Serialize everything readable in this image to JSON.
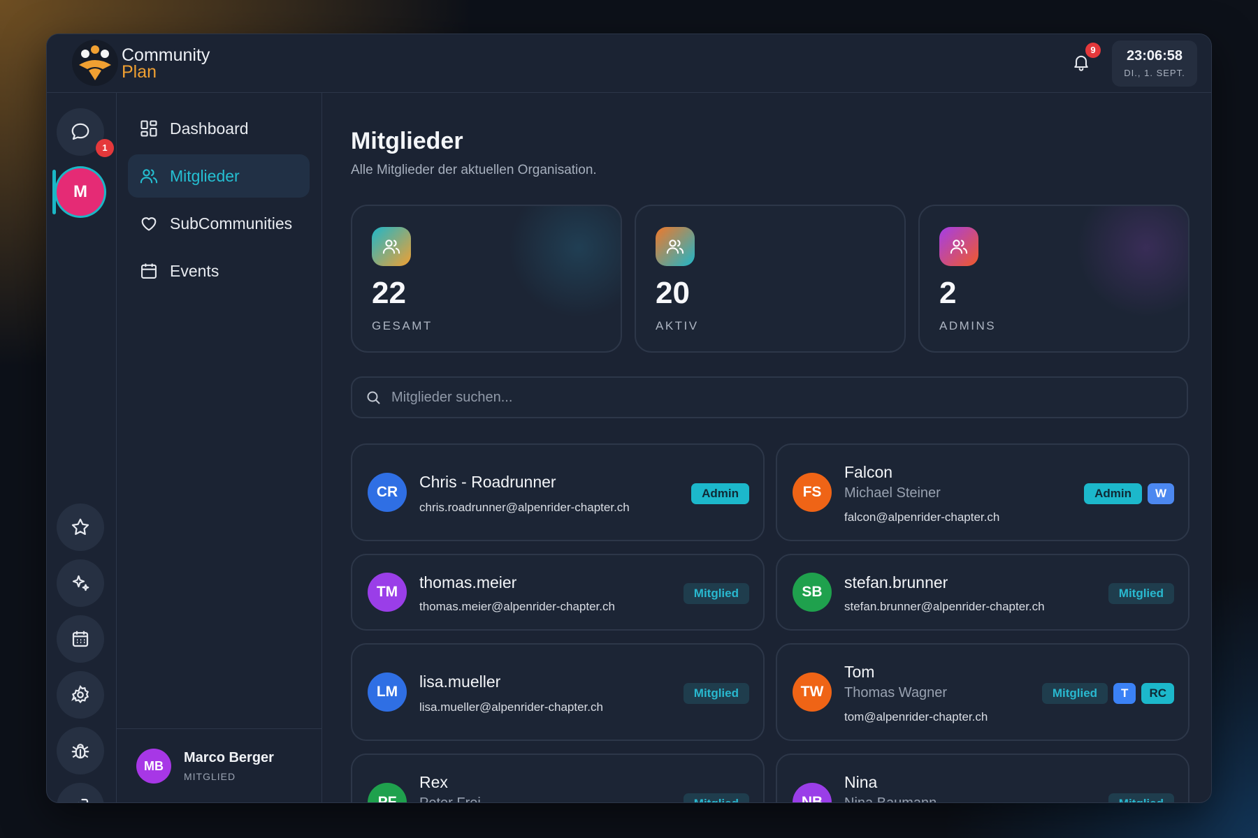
{
  "app": {
    "brand_line1": "Community",
    "brand_line2": "Plan"
  },
  "header": {
    "notification_count": "9",
    "time": "23:06:58",
    "date": "DI., 1. SEPT."
  },
  "rail": {
    "chat_badge": "1",
    "org_initial": "M"
  },
  "nav": {
    "items": [
      {
        "label": "Dashboard",
        "icon": "grid-icon"
      },
      {
        "label": "Mitglieder",
        "icon": "users-icon",
        "active": true
      },
      {
        "label": "SubCommunities",
        "icon": "heart-icon"
      },
      {
        "label": "Events",
        "icon": "calendar-icon"
      }
    ]
  },
  "user": {
    "initials": "MB",
    "name": "Marco Berger",
    "role": "MITGLIED"
  },
  "page": {
    "title": "Mitglieder",
    "subtitle": "Alle Mitglieder der aktuellen Organisation."
  },
  "stats": [
    {
      "value": "22",
      "label": "GESAMT"
    },
    {
      "value": "20",
      "label": "AKTIV"
    },
    {
      "value": "2",
      "label": "ADMINS"
    }
  ],
  "search": {
    "placeholder": "Mitglieder suchen..."
  },
  "members": [
    {
      "initials": "CR",
      "name": "Chris - Roadrunner",
      "realname": "",
      "email": "chris.roadrunner@alpenrider-chapter.ch",
      "badges": [
        "Admin"
      ]
    },
    {
      "initials": "FS",
      "name": "Falcon",
      "realname": "Michael Steiner",
      "email": "falcon@alpenrider-chapter.ch",
      "badges": [
        "Admin",
        "W"
      ]
    },
    {
      "initials": "TM",
      "name": "thomas.meier",
      "realname": "",
      "email": "thomas.meier@alpenrider-chapter.ch",
      "badges": [
        "Mitglied"
      ]
    },
    {
      "initials": "SB",
      "name": "stefan.brunner",
      "realname": "",
      "email": "stefan.brunner@alpenrider-chapter.ch",
      "badges": [
        "Mitglied"
      ]
    },
    {
      "initials": "LM",
      "name": "lisa.mueller",
      "realname": "",
      "email": "lisa.mueller@alpenrider-chapter.ch",
      "badges": [
        "Mitglied"
      ]
    },
    {
      "initials": "TW",
      "name": "Tom",
      "realname": "Thomas Wagner",
      "email": "tom@alpenrider-chapter.ch",
      "badges": [
        "Mitglied",
        "T",
        "RC"
      ]
    },
    {
      "initials": "PF",
      "name": "Rex",
      "realname": "Peter Frei",
      "email": "",
      "badges": [
        "Mitglied"
      ]
    },
    {
      "initials": "NB",
      "name": "Nina",
      "realname": "Nina Baumann",
      "email": "",
      "badges": [
        "Mitglied"
      ]
    }
  ],
  "colors": {
    "accent": "#1bb7c6",
    "brand_orange": "#f0a032",
    "org_avatar": "#e52b75",
    "avatar_cr": "#2f6fe4",
    "avatar_fs": "#ef6416",
    "avatar_tm": "#9a3ee8",
    "avatar_sb": "#1fa14d",
    "avatar_lm": "#2f6fe4",
    "avatar_tw": "#ef6416",
    "avatar_pf": "#1fa14d",
    "avatar_nb": "#9a3ee8"
  }
}
